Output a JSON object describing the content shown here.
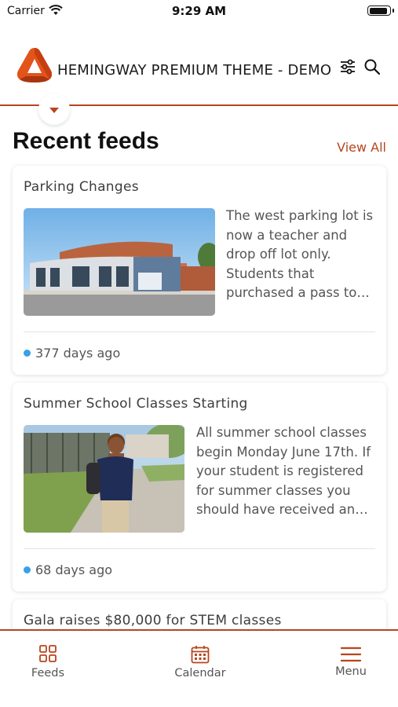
{
  "status_bar": {
    "carrier": "Carrier",
    "time": "9:29 AM",
    "battery_level": 0.9
  },
  "header": {
    "title": "HEMINGWAY PREMIUM THEME - DEMO",
    "logo_icon": "hemingway-logo",
    "filter_icon": "sliders-icon",
    "search_icon": "search-icon",
    "collapse_icon": "chevron-down-icon"
  },
  "section": {
    "title": "Recent feeds",
    "view_all_label": "View All"
  },
  "feeds": [
    {
      "title": "Parking Changes",
      "excerpt": "The west parking lot is now a teacher and drop off lot only. Students that purchased a pass to…",
      "time_ago": "377 days ago",
      "image": "school-building-photo"
    },
    {
      "title": "Summer School Classes Starting",
      "excerpt": "All summer school classes begin Monday June 17th. If your student is registered for summer classes you should have received an…",
      "time_ago": "68 days ago",
      "image": "student-with-backpack-photo"
    },
    {
      "title": "Gala raises $80,000 for STEM classes"
    }
  ],
  "tabbar": {
    "items": [
      {
        "label": "Feeds",
        "icon": "grid-icon"
      },
      {
        "label": "Calendar",
        "icon": "calendar-icon"
      },
      {
        "label": "Menu",
        "icon": "menu-icon"
      }
    ]
  },
  "colors": {
    "accent": "#b8451d",
    "logo_orange": "#e2541a",
    "dot_blue": "#3aa0e8"
  }
}
